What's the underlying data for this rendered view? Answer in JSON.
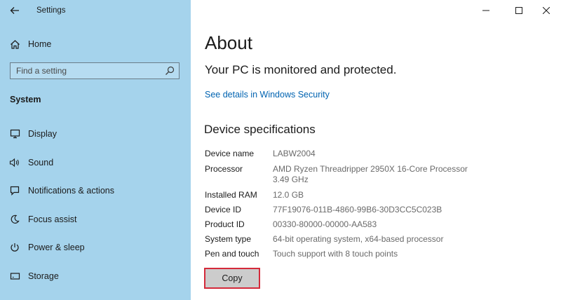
{
  "app": {
    "title": "Settings",
    "back_icon": "back-arrow-icon"
  },
  "window_controls": {
    "minimize_icon": "minimize-icon",
    "maximize_icon": "maximize-icon",
    "close_icon": "close-icon"
  },
  "sidebar": {
    "home_label": "Home",
    "search_placeholder": "Find a setting",
    "section_label": "System",
    "items": [
      {
        "label": "Display",
        "icon": "display-icon"
      },
      {
        "label": "Sound",
        "icon": "sound-icon"
      },
      {
        "label": "Notifications & actions",
        "icon": "notifications-icon"
      },
      {
        "label": "Focus assist",
        "icon": "focus-assist-icon"
      },
      {
        "label": "Power & sleep",
        "icon": "power-icon"
      },
      {
        "label": "Storage",
        "icon": "storage-icon"
      }
    ]
  },
  "main": {
    "title": "About",
    "protection_text": "Your PC is monitored and protected.",
    "security_link": "See details in Windows Security",
    "specs_heading": "Device specifications",
    "specs": [
      {
        "label": "Device name",
        "value": "LABW2004"
      },
      {
        "label": "Processor",
        "value": "AMD Ryzen Threadripper 2950X 16-Core Processor",
        "value2": "3.49 GHz"
      },
      {
        "label": "Installed RAM",
        "value": "12.0 GB"
      },
      {
        "label": "Device ID",
        "value": "77F19076-011B-4860-99B6-30D3CC5C023B"
      },
      {
        "label": "Product ID",
        "value": "00330-80000-00000-AA583"
      },
      {
        "label": "System type",
        "value": "64-bit operating system, x64-based processor"
      },
      {
        "label": "Pen and touch",
        "value": "Touch support with 8 touch points"
      }
    ],
    "copy_label": "Copy"
  },
  "colors": {
    "sidebar_bg": "#a5d3ec",
    "link": "#0063b1",
    "highlight_border": "#d42a3a"
  }
}
